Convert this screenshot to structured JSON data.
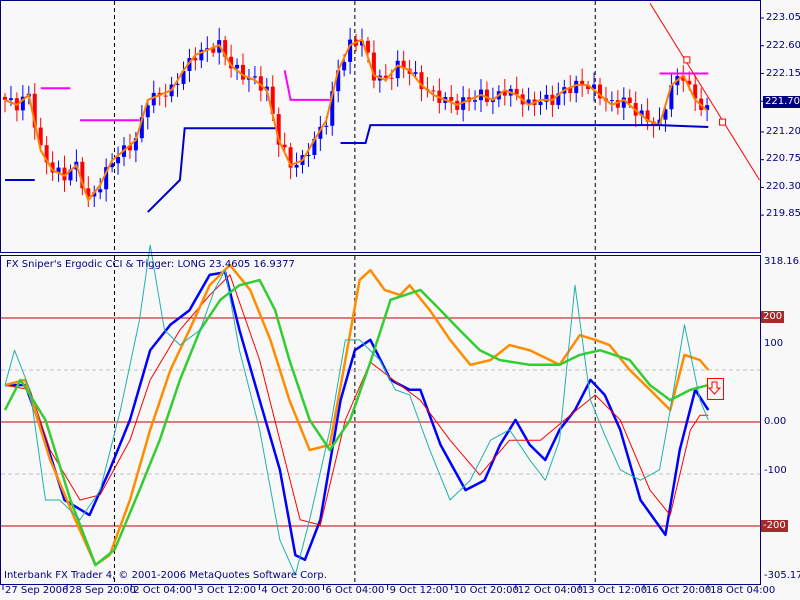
{
  "indicator_title": "FX Sniper's Ergodic CCI & Trigger: LONG 23.4605 16.9377",
  "footer": "Interbank FX Trader 4, © 2001-2006 MetaQuotes Software Corp.",
  "colors": {
    "bull": "#0000ff",
    "bear": "#ff0000",
    "ma": "#ff8000",
    "frame": "#000080",
    "level": "#c00000",
    "badge": "#a52a2a"
  },
  "chart_data": [
    {
      "type": "candlestick",
      "title": "Price",
      "ylim": [
        219.85,
        223.25
      ],
      "yticks": [
        "223.05",
        "222.60",
        "222.15",
        "221.70",
        "221.20",
        "220.75",
        "220.30",
        "219.85"
      ],
      "current_price": "221.70",
      "closes": [
        221.72,
        221.64,
        221.8,
        220.9,
        220.58,
        220.49,
        220.66,
        220.09,
        220.34,
        220.74,
        220.9,
        221.07,
        221.72,
        221.8,
        221.88,
        222.2,
        222.45,
        222.53,
        222.61,
        222.28,
        222.12,
        222.04,
        221.88,
        221.07,
        220.66,
        220.74,
        221.07,
        221.39,
        222.2,
        222.61,
        222.7,
        222.12,
        222.04,
        222.28,
        222.2,
        221.96,
        221.8,
        221.72,
        221.64,
        221.72,
        221.8,
        221.72,
        221.88,
        221.8,
        221.64,
        221.72,
        221.72,
        221.88,
        221.96,
        221.96,
        221.8,
        221.64,
        221.72,
        221.55,
        221.39,
        221.31,
        221.96,
        222.12,
        221.72,
        221.55
      ],
      "stop_lines_magenta": [
        [
          [
            3.0,
            221.91
          ],
          [
            5.5,
            221.91
          ]
        ],
        [
          [
            6.3,
            221.39
          ],
          [
            11.3,
            221.39
          ]
        ],
        [
          [
            23.5,
            222.2
          ],
          [
            24.0,
            221.72
          ],
          [
            27.3,
            221.72
          ]
        ],
        [
          [
            55,
            222.15
          ],
          [
            59.1,
            222.15
          ]
        ]
      ],
      "stop_lines_blue": [
        [
          [
            0,
            220.42
          ],
          [
            2.5,
            220.42
          ]
        ],
        [
          [
            12,
            219.9
          ],
          [
            14.7,
            220.42
          ],
          [
            15.1,
            221.26
          ],
          [
            22.7,
            221.26
          ]
        ],
        [
          [
            28.2,
            221.02
          ],
          [
            30.3,
            221.02
          ],
          [
            30.7,
            221.31
          ],
          [
            55,
            221.31
          ],
          [
            59.1,
            221.28
          ]
        ]
      ],
      "trendline": [
        [
          54.2,
          223.29
        ],
        [
          63.4,
          220.42
        ]
      ],
      "trend_markers": [
        [
          57.3,
          222.37
        ],
        [
          60.3,
          221.36
        ]
      ]
    },
    {
      "type": "line",
      "title": "FX Sniper's Ergodic CCI & Trigger",
      "ylim": [
        -305.175,
        318.1632
      ],
      "yticks": {
        "top": "318.1632",
        "p100": "100",
        "m100": "-100",
        "bottom": "-305.175"
      },
      "levels": {
        "p200": "200",
        "zero": "0.00",
        "m200": "-200"
      },
      "series": [
        {
          "name": "cci-blue",
          "color": "#0000ff",
          "width": 2.5,
          "points": [
            [
              0,
              71
            ],
            [
              1.7,
              71
            ],
            [
              3.4,
              -35
            ],
            [
              5,
              -150
            ],
            [
              7.1,
              -179
            ],
            [
              8.8,
              -92
            ],
            [
              10.5,
              4
            ],
            [
              12.2,
              138
            ],
            [
              13.9,
              187
            ],
            [
              15.5,
              215
            ],
            [
              17.2,
              283
            ],
            [
              18.5,
              288
            ],
            [
              19.7,
              177
            ],
            [
              21.4,
              42
            ],
            [
              23.1,
              -92
            ],
            [
              24.4,
              -256
            ],
            [
              25.2,
              -265
            ],
            [
              26.5,
              -188
            ],
            [
              28.2,
              42
            ],
            [
              29.4,
              138
            ],
            [
              30.7,
              158
            ],
            [
              32.4,
              81
            ],
            [
              34,
              62
            ],
            [
              34.9,
              62
            ],
            [
              36.6,
              -44
            ],
            [
              38.7,
              -131
            ],
            [
              40.3,
              -112
            ],
            [
              41.6,
              -44
            ],
            [
              42.9,
              4
            ],
            [
              44.1,
              -44
            ],
            [
              45.4,
              -73
            ],
            [
              46.6,
              -15
            ],
            [
              47.9,
              23
            ],
            [
              49.2,
              81
            ],
            [
              50.4,
              52
            ],
            [
              51.7,
              -15
            ],
            [
              53.4,
              -150
            ],
            [
              55.5,
              -217
            ],
            [
              56.7,
              -54
            ],
            [
              58,
              62
            ],
            [
              59.1,
              23
            ]
          ]
        },
        {
          "name": "trigger-red",
          "color": "#ff0000",
          "width": 1,
          "points": [
            [
              0,
              71
            ],
            [
              2.1,
              62
            ],
            [
              3.8,
              -54
            ],
            [
              6.3,
              -150
            ],
            [
              8,
              -140
            ],
            [
              10.5,
              -35
            ],
            [
              12.2,
              81
            ],
            [
              14.7,
              177
            ],
            [
              17.2,
              244
            ],
            [
              18.9,
              283
            ],
            [
              21.4,
              119
            ],
            [
              23.1,
              -35
            ],
            [
              24.8,
              -188
            ],
            [
              26.5,
              -198
            ],
            [
              28.6,
              4
            ],
            [
              30.7,
              115
            ],
            [
              33.2,
              71
            ],
            [
              34.9,
              42
            ],
            [
              37.4,
              -35
            ],
            [
              39.9,
              -102
            ],
            [
              42.4,
              -35
            ],
            [
              45,
              -35
            ],
            [
              47.5,
              13
            ],
            [
              49.6,
              52
            ],
            [
              51.7,
              4
            ],
            [
              54.2,
              -131
            ],
            [
              55.9,
              -179
            ],
            [
              57.6,
              -15
            ],
            [
              58.4,
              13
            ],
            [
              59.1,
              13
            ]
          ]
        },
        {
          "name": "slow-orange",
          "color": "#ff8c00",
          "width": 2.5,
          "points": [
            [
              0,
              71
            ],
            [
              1.7,
              81
            ],
            [
              3.8,
              -73
            ],
            [
              5.9,
              -188
            ],
            [
              7.6,
              -275
            ],
            [
              8.8,
              -256
            ],
            [
              10.5,
              -150
            ],
            [
              12.2,
              -15
            ],
            [
              13.9,
              100
            ],
            [
              15.5,
              177
            ],
            [
              17.2,
              263
            ],
            [
              18.9,
              302
            ],
            [
              20.6,
              254
            ],
            [
              22.3,
              158
            ],
            [
              23.9,
              42
            ],
            [
              25.6,
              -54
            ],
            [
              27.3,
              -44
            ],
            [
              28.6,
              119
            ],
            [
              29.8,
              273
            ],
            [
              30.7,
              292
            ],
            [
              31.9,
              254
            ],
            [
              33.2,
              244
            ],
            [
              34,
              263
            ],
            [
              35.7,
              215
            ],
            [
              37.4,
              158
            ],
            [
              39.1,
              110
            ],
            [
              40.8,
              119
            ],
            [
              42.4,
              148
            ],
            [
              44.1,
              138
            ],
            [
              46.6,
              110
            ],
            [
              48.3,
              167
            ],
            [
              49.6,
              158
            ],
            [
              50.8,
              148
            ],
            [
              52.5,
              100
            ],
            [
              54.2,
              62
            ],
            [
              55.9,
              23
            ],
            [
              57.1,
              129
            ],
            [
              58.4,
              119
            ],
            [
              59.1,
              100
            ]
          ]
        },
        {
          "name": "slow-green",
          "color": "#32cd32",
          "width": 2.5,
          "points": [
            [
              0,
              23
            ],
            [
              1.3,
              81
            ],
            [
              3.4,
              4
            ],
            [
              5.5,
              -150
            ],
            [
              7.6,
              -275
            ],
            [
              9.2,
              -246
            ],
            [
              11.3,
              -131
            ],
            [
              13,
              -35
            ],
            [
              14.7,
              81
            ],
            [
              16.4,
              177
            ],
            [
              18.1,
              235
            ],
            [
              19.7,
              263
            ],
            [
              21.4,
              273
            ],
            [
              22.7,
              215
            ],
            [
              23.9,
              119
            ],
            [
              25.6,
              4
            ],
            [
              27.3,
              -54
            ],
            [
              29,
              4
            ],
            [
              30.7,
              115
            ],
            [
              32.4,
              235
            ],
            [
              34.9,
              254
            ],
            [
              36.6,
              215
            ],
            [
              38.2,
              177
            ],
            [
              39.9,
              138
            ],
            [
              41.6,
              119
            ],
            [
              44.1,
              110
            ],
            [
              46.6,
              110
            ],
            [
              48.3,
              129
            ],
            [
              50,
              138
            ],
            [
              52.5,
              119
            ],
            [
              54.2,
              71
            ],
            [
              55.9,
              42
            ],
            [
              57.6,
              62
            ],
            [
              59.1,
              71
            ]
          ]
        },
        {
          "name": "fast-cyan",
          "color": "#20b2aa",
          "width": 1,
          "points": [
            [
              0,
              71
            ],
            [
              0.8,
              138
            ],
            [
              2.1,
              62
            ],
            [
              3.4,
              -150
            ],
            [
              4.6,
              -150
            ],
            [
              6.3,
              -188
            ],
            [
              8,
              -131
            ],
            [
              9.7,
              23
            ],
            [
              11.3,
              196
            ],
            [
              12.2,
              340
            ],
            [
              13.4,
              177
            ],
            [
              14.7,
              148
            ],
            [
              16.4,
              177
            ],
            [
              17.6,
              254
            ],
            [
              18.5,
              292
            ],
            [
              19.7,
              138
            ],
            [
              21.4,
              -15
            ],
            [
              23.1,
              -227
            ],
            [
              24.4,
              -294
            ],
            [
              25.6,
              -188
            ],
            [
              27.3,
              -15
            ],
            [
              28.6,
              158
            ],
            [
              29.8,
              158
            ],
            [
              31.5,
              119
            ],
            [
              32.8,
              62
            ],
            [
              34,
              52
            ],
            [
              35.7,
              -54
            ],
            [
              37.4,
              -150
            ],
            [
              39.1,
              -112
            ],
            [
              40.8,
              -35
            ],
            [
              42.4,
              -15
            ],
            [
              44.1,
              -73
            ],
            [
              45.4,
              -112
            ],
            [
              46.6,
              -35
            ],
            [
              47.9,
              263
            ],
            [
              49.2,
              42
            ],
            [
              50.4,
              -25
            ],
            [
              51.7,
              -92
            ],
            [
              53.4,
              -112
            ],
            [
              55,
              -92
            ],
            [
              55.9,
              23
            ],
            [
              57.1,
              187
            ],
            [
              58.4,
              42
            ],
            [
              59.1,
              4
            ]
          ]
        }
      ]
    }
  ],
  "separators": [
    9.2,
    29.4,
    49.6
  ],
  "time_labels": [
    "27 Sep 2006",
    "28 Sep 20:00",
    "2 Oct 04:00",
    "3 Oct 12:00",
    "4 Oct 20:00",
    "6 Oct 04:00",
    "9 Oct 12:00",
    "10 Oct 20:00",
    "12 Oct 04:00",
    "13 Oct 12:00",
    "16 Oct 20:00",
    "18 Oct 04:00"
  ],
  "signal_icon": "down-arrow-icon"
}
